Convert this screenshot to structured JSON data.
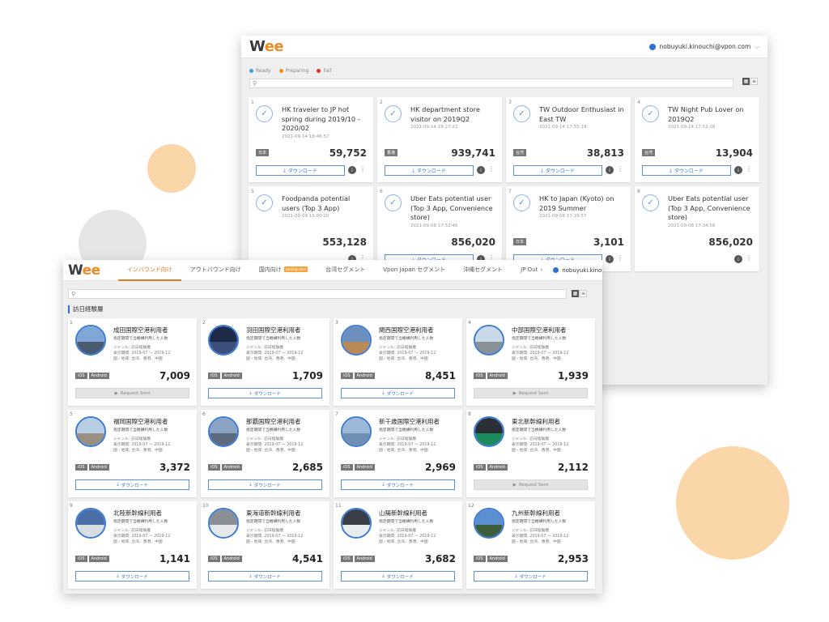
{
  "back_window": {
    "logo": "Wee",
    "user_email": "nobuyuki.kinouchi@vpon.com",
    "legend": [
      {
        "label": "Ready",
        "color": "#3aa0e0"
      },
      {
        "label": "Preparing",
        "color": "#f08a24"
      },
      {
        "label": "Fail",
        "color": "#d9302f"
      }
    ],
    "download_label": "ダウンロード",
    "cards": [
      {
        "num": "1",
        "title": "HK traveler to JP hot spring during 2019/10 - 2020/02",
        "date": "2021-09-14 18:46:57",
        "tag": "日本",
        "count": "59,752"
      },
      {
        "num": "2",
        "title": "HK department store visitor on 2019Q2",
        "date": "2021-09-14 18:27:22",
        "tag": "香港",
        "count": "939,741"
      },
      {
        "num": "3",
        "title": "TW Outdoor Enthusiast in East TW",
        "date": "2021-09-14 17:55:19",
        "tag": "台湾",
        "count": "38,813"
      },
      {
        "num": "4",
        "title": "TW Night Pub Lover on 2019Q2",
        "date": "2021-09-14 17:52:16",
        "tag": "台湾",
        "count": "13,904"
      },
      {
        "num": "5",
        "title": "Foodpanda potential users (Top 3 App)",
        "date": "2021-09-09 15:00:20",
        "tag": "",
        "count": "553,128"
      },
      {
        "num": "6",
        "title": "Uber Eats potential user (Top 3 App, Convenience store)",
        "date": "2021-09-08 17:52:46",
        "tag": "",
        "count": "856,020"
      },
      {
        "num": "7",
        "title": "HK to Japan (Kyoto) on 2019 Summer",
        "date": "2021-09-08 17:39:57",
        "tag": "日本",
        "count": "3,101"
      },
      {
        "num": "8",
        "title": "Uber Eats potential user (Top 3 App, Convenience store)",
        "date": "2021-09-08 17:34:56",
        "tag": "",
        "count": "856,020"
      }
    ]
  },
  "front_window": {
    "logo": "Wee",
    "tabs": [
      "インバウンド向け",
      "アウトバウンド向け",
      "国内向け",
      "台湾セグメント",
      "Vpon Japan セグメント",
      "沖縄セグメント",
      "JP Out"
    ],
    "coming_soon": "coming soon",
    "user_email": "nobuyuki.kinouchi@vpon.com",
    "section_title": "訪日経験層",
    "download_label": "ダウンロード",
    "sent_label": "Request Sent",
    "platforms": [
      "iOS",
      "Android"
    ],
    "cards": [
      {
        "num": "1",
        "title": "成田国際空港利用者",
        "sub": "指定期間で当機構利用した人数",
        "genre": "ジャンル: 訪日経験層",
        "period": "表示期間: 2019-07 ～ 2019-12",
        "region": "国・地域: 台湾、香港、中国",
        "count": "7,009",
        "action": "sent",
        "sky": "#7fa8d8",
        "ground": "#4a5a70"
      },
      {
        "num": "2",
        "title": "羽田国際空港利用者",
        "sub": "指定期間で当機構利用した人数",
        "genre": "ジャンル: 訪日経験層",
        "period": "表示期間: 2019-07 ～ 2019-12",
        "region": "国・地域: 台湾、香港、中国",
        "count": "1,709",
        "action": "download",
        "sky": "#1d2a4a",
        "ground": "#3b4f7a"
      },
      {
        "num": "3",
        "title": "関西国際空港利用者",
        "sub": "指定期間で当機構利用した人数",
        "genre": "ジャンル: 訪日経験層",
        "period": "表示期間: 2019-07 ～ 2019-12",
        "region": "国・地域: 台湾、香港、中国",
        "count": "8,451",
        "action": "download",
        "sky": "#6d8fbd",
        "ground": "#b88a55"
      },
      {
        "num": "4",
        "title": "中部国際空港利用者",
        "sub": "指定期間で当機構利用した人数",
        "genre": "ジャンル: 訪日経験層",
        "period": "表示期間: 2019-07 ～ 2019-12",
        "region": "国・地域: 台湾、香港、中国",
        "count": "1,939",
        "action": "sent",
        "sky": "#c9d9ea",
        "ground": "#8a9098"
      },
      {
        "num": "5",
        "title": "福岡国際空港利用者",
        "sub": "指定期間で当機構利用した人数",
        "genre": "ジャンル: 訪日経験層",
        "period": "表示期間: 2019-07 ～ 2019-12",
        "region": "国・地域: 台湾、香港、中国",
        "count": "3,372",
        "action": "download",
        "sky": "#b9cde3",
        "ground": "#9a8f82"
      },
      {
        "num": "6",
        "title": "那覇国際空港利用者",
        "sub": "指定期間で当機構利用した人数",
        "genre": "ジャンル: 訪日経験層",
        "period": "表示期間: 2019-07 ～ 2019-12",
        "region": "国・地域: 台湾、香港、中国",
        "count": "2,685",
        "action": "download",
        "sky": "#8aa3c4",
        "ground": "#5d6a7d"
      },
      {
        "num": "7",
        "title": "新千歳国際空港利用者",
        "sub": "指定期間で当機構利用した人数",
        "genre": "ジャンル: 訪日経験層",
        "period": "表示期間: 2019-07 ～ 2019-12",
        "region": "国・地域: 台湾、香港、中国",
        "count": "2,969",
        "action": "download",
        "sky": "#9db8d6",
        "ground": "#6f8fb3"
      },
      {
        "num": "8",
        "title": "東北新幹線利用者",
        "sub": "指定期間で当機構利用した人数",
        "genre": "ジャンル: 訪日経験層",
        "period": "表示期間: 2019-07 ～ 2019-12",
        "region": "国・地域: 台湾、香港、中国",
        "count": "2,112",
        "action": "sent",
        "sky": "#2a2e35",
        "ground": "#1c8a5a"
      },
      {
        "num": "9",
        "title": "北陸新幹線利用者",
        "sub": "指定期間で当機構利用した人数",
        "genre": "ジャンル: 訪日経験層",
        "period": "表示期間: 2019-07 ～ 2019-12",
        "region": "国・地域: 台湾、香港、中国",
        "count": "1,141",
        "action": "download",
        "sky": "#4a6fa8",
        "ground": "#d8dde4"
      },
      {
        "num": "10",
        "title": "東海道新幹線利用者",
        "sub": "指定期間で当機構利用した人数",
        "genre": "ジャンル: 訪日経験層",
        "period": "表示期間: 2019-07 ～ 2019-12",
        "region": "国・地域: 台湾、香港、中国",
        "count": "4,541",
        "action": "download",
        "sky": "#8a8f96",
        "ground": "#e6e8ea"
      },
      {
        "num": "11",
        "title": "山陽新幹線利用者",
        "sub": "指定期間で当機構利用した人数",
        "genre": "ジャンル: 訪日経験層",
        "period": "表示期間: 2019-07 ～ 2019-12",
        "region": "国・地域: 台湾、香港、中国",
        "count": "3,682",
        "action": "download",
        "sky": "#3a3f47",
        "ground": "#e9ecef"
      },
      {
        "num": "12",
        "title": "九州新幹線利用者",
        "sub": "指定期間で当機構利用した人数",
        "genre": "ジャンル: 訪日経験層",
        "period": "表示期間: 2019-07 ～ 2019-12",
        "region": "国・地域: 台湾、香港、中国",
        "count": "2,953",
        "action": "download",
        "sky": "#5b8fd0",
        "ground": "#3d5e3a"
      }
    ]
  }
}
